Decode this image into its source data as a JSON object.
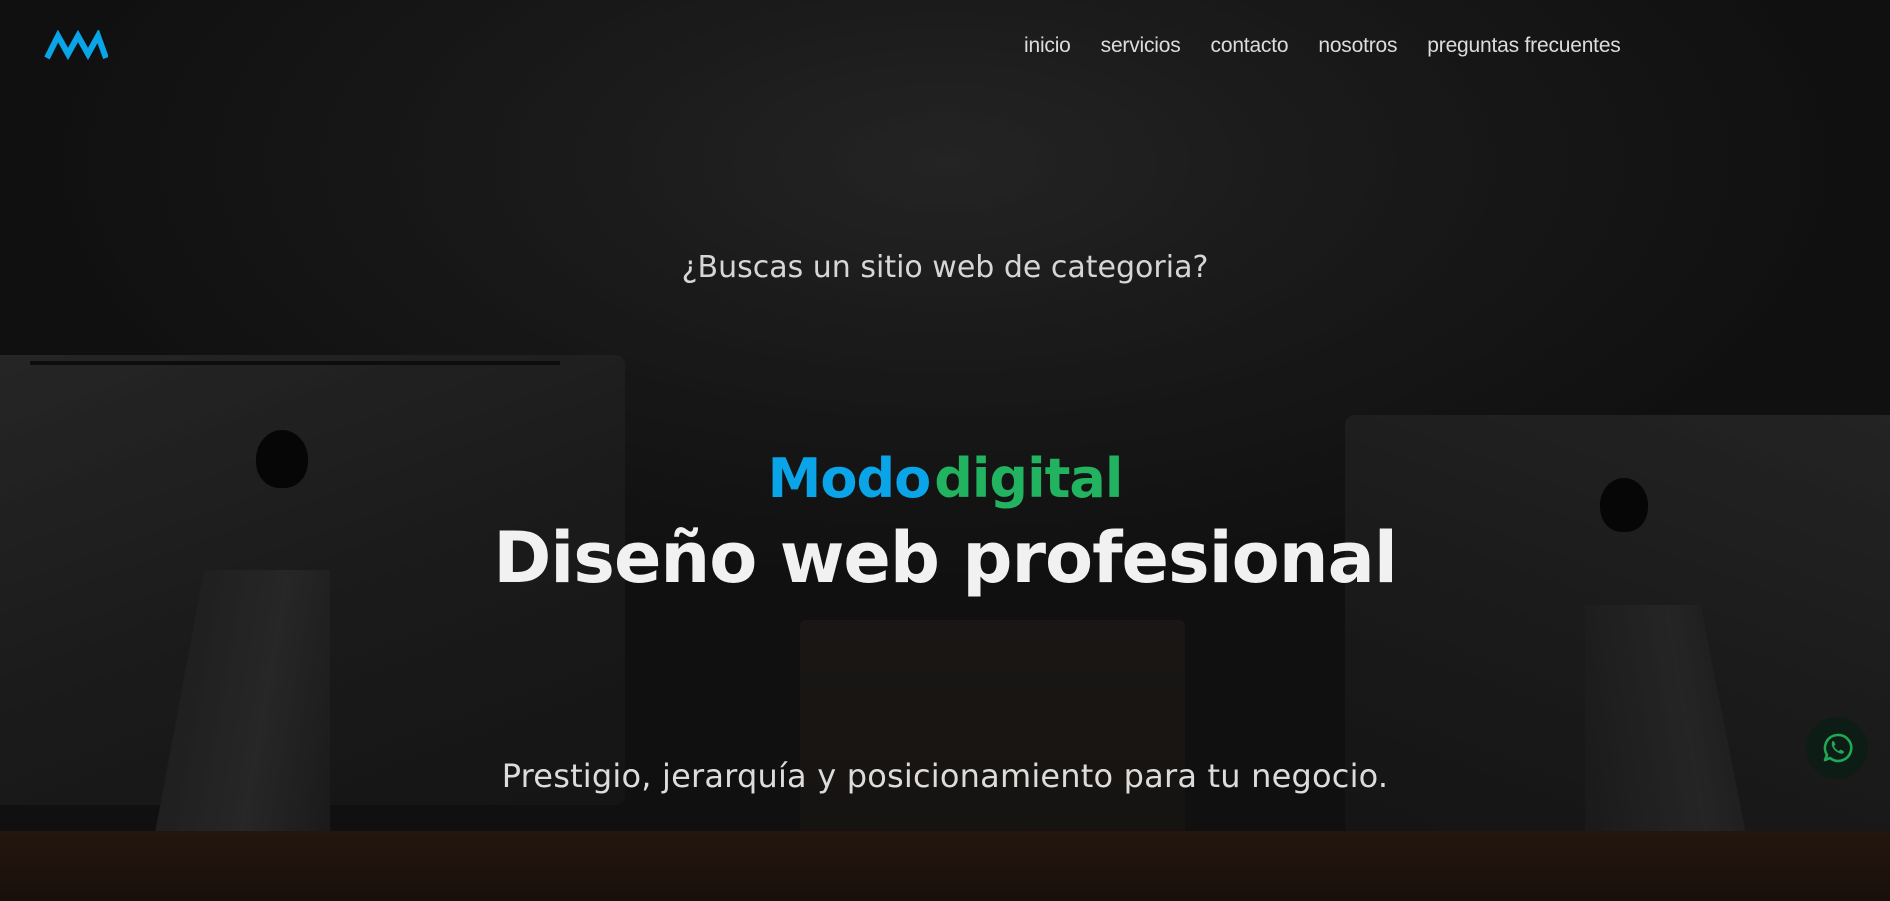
{
  "nav": {
    "logo_icon": "mm-zigzag-logo",
    "items": [
      {
        "label": "inicio"
      },
      {
        "label": "servicios"
      },
      {
        "label": "contacto"
      },
      {
        "label": "nosotros"
      },
      {
        "label": "preguntas frecuentes"
      }
    ]
  },
  "hero": {
    "tagline": "¿Buscas un sitio web de categoria?",
    "brand_part1": "Modo",
    "brand_part2": "digital",
    "headline": "Diseño web profesional",
    "subline": "Prestigio, jerarquía y posicionamiento para tu negocio."
  },
  "floating": {
    "whatsapp_icon": "whatsapp-icon"
  },
  "colors": {
    "brand_blue": "#0aa5e8",
    "brand_green": "#21b35f",
    "whatsapp_green": "#1fa855",
    "nav_text": "#dcdcdc",
    "background": "#1e1e1e"
  }
}
